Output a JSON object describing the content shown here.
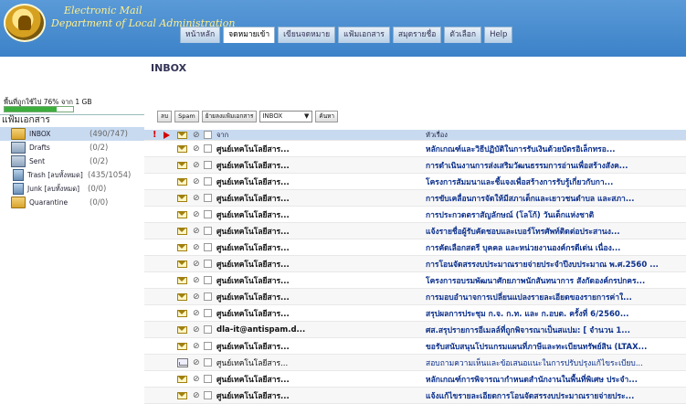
{
  "header": {
    "title_line1": "Electronic Mail",
    "title_line2": "Department of Local Administration",
    "tabs": [
      {
        "label": "หน้าหลัก",
        "active": false
      },
      {
        "label": "จดหมายเข้า",
        "active": true
      },
      {
        "label": "เขียนจดหมาย",
        "active": false
      },
      {
        "label": "แฟ้มเอกสาร",
        "active": false
      },
      {
        "label": "สมุดรายชื่อ",
        "active": false
      },
      {
        "label": "ตัวเลือก",
        "active": false
      },
      {
        "label": "Help",
        "active": false
      }
    ]
  },
  "quota": {
    "text": "พื้นที่ถูกใช้ไป 76% จาก 1 GB",
    "percent": 76
  },
  "folders": {
    "heading": "แฟ้มเอกสาร",
    "items": [
      {
        "name": "INBOX",
        "count": "(490/747)",
        "icon": "inbox-folder-icon",
        "selected": true
      },
      {
        "name": "Drafts",
        "count": "(0/2)",
        "icon": "drafts-folder-icon",
        "selected": false
      },
      {
        "name": "Sent",
        "count": "(0/2)",
        "icon": "sent-folder-icon",
        "selected": false
      },
      {
        "name": "Trash [ลบทั้งหมด]",
        "count": "(435/1054)",
        "icon": "trash-folder-icon",
        "selected": false
      },
      {
        "name": "Junk [ลบทั้งหมด]",
        "count": "(0/0)",
        "icon": "junk-folder-icon",
        "selected": false
      },
      {
        "name": "Quarantine",
        "count": "(0/0)",
        "icon": "quarantine-folder-icon",
        "selected": false
      }
    ]
  },
  "main": {
    "title": "INBOX",
    "toolbar": {
      "delete_label": "ลบ",
      "spam_label": "Spam",
      "move_label": "ย้ายลงแฟ้มเอกสาร",
      "folder_select_value": "INBOX",
      "search_label": "ค้นหา"
    },
    "columns": {
      "from": "จาก",
      "subject": "หัวเรื่อง"
    },
    "messages": [
      {
        "from": "ศูนย์เทคโนโลยีสาร...",
        "subject": "หลักเกณฑ์และวิธีปฏิบัติในการรับเงินด้วยบัตรอิเล็กทรอ...",
        "unread": true,
        "opened": false
      },
      {
        "from": "ศูนย์เทคโนโลยีสาร...",
        "subject": "การดำเนินงานการส่งเสริมวัฒนธรรมการอ่านเพื่อสร้างสังค...",
        "unread": true,
        "opened": false
      },
      {
        "from": "ศูนย์เทคโนโลยีสาร...",
        "subject": "โครงการสัมมนาและชี้แจงเพื่อสร้างการรับรู้เกี่ยวกับกา...",
        "unread": true,
        "opened": false
      },
      {
        "from": "ศูนย์เทคโนโลยีสาร...",
        "subject": "การขับเคลื่อนการจัดให้มีสภาเด็กและเยาวชนตำบล และสภา...",
        "unread": true,
        "opened": false
      },
      {
        "from": "ศูนย์เทคโนโลยีสาร...",
        "subject": "การประกวดตราสัญลักษณ์ (โลโก้) วันเด็กแห่งชาติ",
        "unread": true,
        "opened": false
      },
      {
        "from": "ศูนย์เทคโนโลยีสาร...",
        "subject": "แจ้งรายชื่อผู้รับคัดชอบและเบอร์โทรศัพท์ติดต่อประสานง...",
        "unread": true,
        "opened": false
      },
      {
        "from": "ศูนย์เทคโนโลยีสาร...",
        "subject": "การคัดเลือกสตรี บุคคล และหน่วยงานองค์กรดีเด่น เนื่อง...",
        "unread": true,
        "opened": false
      },
      {
        "from": "ศูนย์เทคโนโลยีสาร...",
        "subject": "การโอนจัดสรรงบประมาณรายจ่ายประจำปีงบประมาณ พ.ศ.2560 ...",
        "unread": true,
        "opened": false
      },
      {
        "from": "ศูนย์เทคโนโลยีสาร...",
        "subject": "โครงการอบรมพัฒนาศักยภาพนักสันทนาการ สังกัดองค์กรปกคร...",
        "unread": true,
        "opened": false
      },
      {
        "from": "ศูนย์เทคโนโลยีสาร...",
        "subject": "การมอบอำนาจการเปลี่ยนแปลงรายละเอียดของรายการค่าใ...",
        "unread": true,
        "opened": false
      },
      {
        "from": "ศูนย์เทคโนโลยีสาร...",
        "subject": "สรุปผลการประชุม ก.จ. ก.ท. และ ก.อบต. ครั้งที่ 6/2560...",
        "unread": true,
        "opened": false
      },
      {
        "from": "dla-it@antispam.d...",
        "subject": "ศส.สรุปรายการอีเมลล์ที่ถูกพิจารณาเป็นสแปม: [ จำนวน 1...",
        "unread": true,
        "opened": false
      },
      {
        "from": "ศูนย์เทคโนโลยีสาร...",
        "subject": "ขอรับสนับสนุนโปรแกรมแผนที่ภาษีและทะเบียนทรัพย์สิน (LTAX...",
        "unread": true,
        "opened": false
      },
      {
        "from": "ศูนย์เทคโนโลยีสาร...",
        "subject": "สอบถามความเห็นและข้อเสนอแนะในการปรับปรุงแก้ไขระเบียบ...",
        "unread": false,
        "opened": true
      },
      {
        "from": "ศูนย์เทคโนโลยีสาร...",
        "subject": "หลักเกณฑ์การพิจารณากำหนดสำนักงานในพื้นที่พิเศษ ประจำ...",
        "unread": true,
        "opened": false
      },
      {
        "from": "ศูนย์เทคโนโลยีสาร...",
        "subject": "แจ้งแก้ไขรายละเอียดการโอนจัดสรรงบประมาณรายจ่ายประ...",
        "unread": true,
        "opened": false
      }
    ]
  }
}
